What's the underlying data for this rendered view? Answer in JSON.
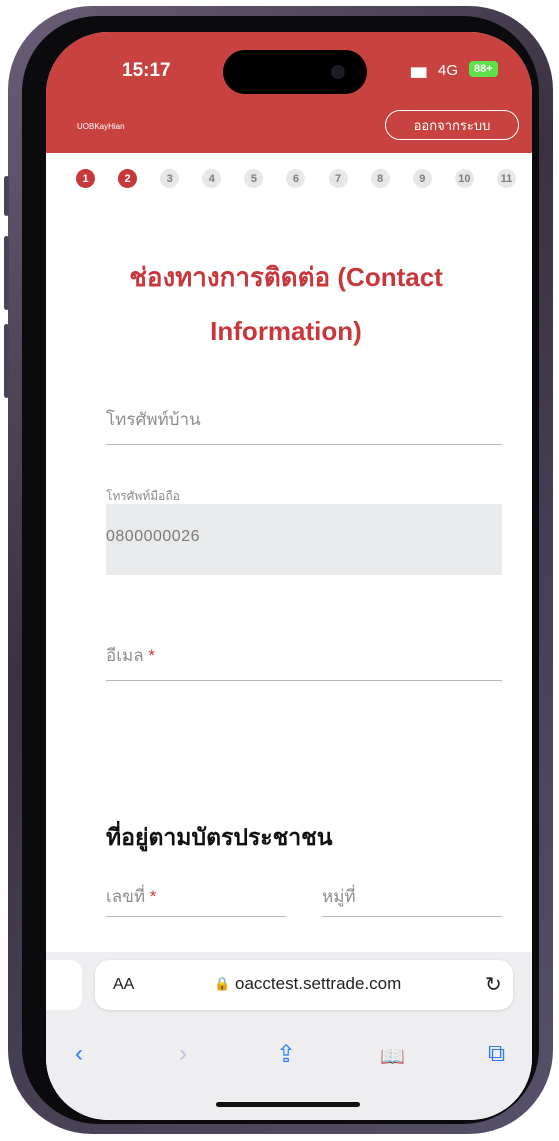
{
  "status": {
    "time": "15:17",
    "signal": "▮▮▮",
    "network": "4G",
    "battery": "88+"
  },
  "header": {
    "logo_text": "UOBKayHian",
    "logout_label": "ออกจากระบบ"
  },
  "steps": [
    "1",
    "2",
    "3",
    "4",
    "5",
    "6",
    "7",
    "8",
    "9",
    "10",
    "11"
  ],
  "page_title": [
    "ช่องทางการติดต่อ (Contact",
    "Information)"
  ],
  "fields": {
    "home_phone_label": "โทรศัพท์บ้าน",
    "mobile_label": "โทรศัพท์มือถือ",
    "mobile_value": "0800000026",
    "email_label": "อีเมล",
    "required_mark": "*",
    "house_no_label": "เลขที่",
    "village_no_label": "หมู่ที่"
  },
  "section_title": "ที่อยู่ตามบัตรประชาชน",
  "browser": {
    "text_size_label": "AA",
    "lock_icon": "🔒",
    "url": "oacctest.settrade.com",
    "reload_icon": "↻",
    "back_icon": "‹",
    "forward_icon": "›",
    "share_icon": "⇪",
    "bookmarks_icon": "📖",
    "tabs_icon": "⧉"
  },
  "colors": {
    "brand_red": "#c8373a",
    "header_red": "#c8433f",
    "battery_green": "#5ee04a",
    "link_blue": "#2f7bf6"
  }
}
